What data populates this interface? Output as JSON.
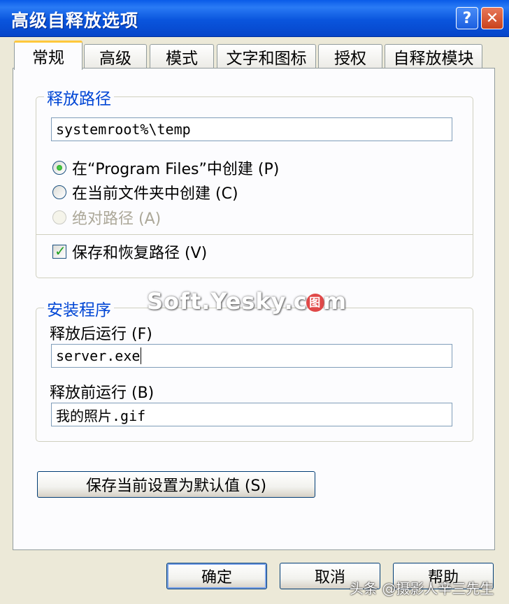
{
  "window": {
    "title": "高级自释放选项",
    "help_glyph": "?",
    "close_glyph": "✕"
  },
  "tabs": [
    {
      "label": "常规",
      "active": true
    },
    {
      "label": "高级",
      "active": false
    },
    {
      "label": "模式",
      "active": false
    },
    {
      "label": "文字和图标",
      "active": false
    },
    {
      "label": "授权",
      "active": false
    },
    {
      "label": "自释放模块",
      "active": false
    }
  ],
  "release_path": {
    "legend": "释放路径",
    "path_value": "systemroot%\\temp",
    "options": [
      {
        "label": "在“Program Files”中创建 (P)",
        "checked": true,
        "disabled": false
      },
      {
        "label": "在当前文件夹中创建 (C)",
        "checked": false,
        "disabled": false
      },
      {
        "label": "绝对路径 (A)",
        "checked": false,
        "disabled": true
      }
    ],
    "save_restore_label": "保存和恢复路径 (V)",
    "save_restore_checked": true
  },
  "setup": {
    "legend": "安装程序",
    "run_after_label": "释放后运行 (F)",
    "run_after_value": "server.exe",
    "run_before_label": "释放前运行 (B)",
    "run_before_value": "我的照片.gif"
  },
  "buttons": {
    "save_default": "保存当前设置为默认值 (S)",
    "ok": "确定",
    "cancel": "取消",
    "help": "帮助"
  },
  "watermark": {
    "text_a": "Soft.Yesky.c",
    "text_b": "m",
    "icon_glyph": "图"
  },
  "credit": "头条 @摄影人辛三先生",
  "colors": {
    "title_bar": "#0A55DD",
    "group_legend": "#0046D5",
    "dialog_bg": "#ECE9D8",
    "tab_highlight": "#FFC83C"
  }
}
